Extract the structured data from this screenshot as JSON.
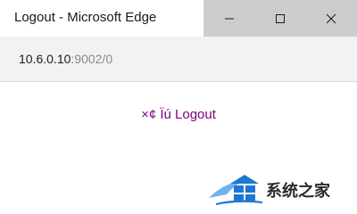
{
  "window": {
    "title": "Logout - Microsoft Edge",
    "controls": [
      "minimize-icon",
      "maximize-icon",
      "close-icon"
    ]
  },
  "address_bar": {
    "host": "10.6.0.10",
    "rest": ":9002/0"
  },
  "content": {
    "logout_link": "×¢ Ïú Logout"
  },
  "watermark": {
    "text": "系统之家",
    "icon": "windows-house-logo-icon"
  },
  "colors": {
    "link": "#800080",
    "caption_bg": "#cccccc",
    "address_bg": "#f2f2f2",
    "logo_blue": "#1e78d2"
  }
}
